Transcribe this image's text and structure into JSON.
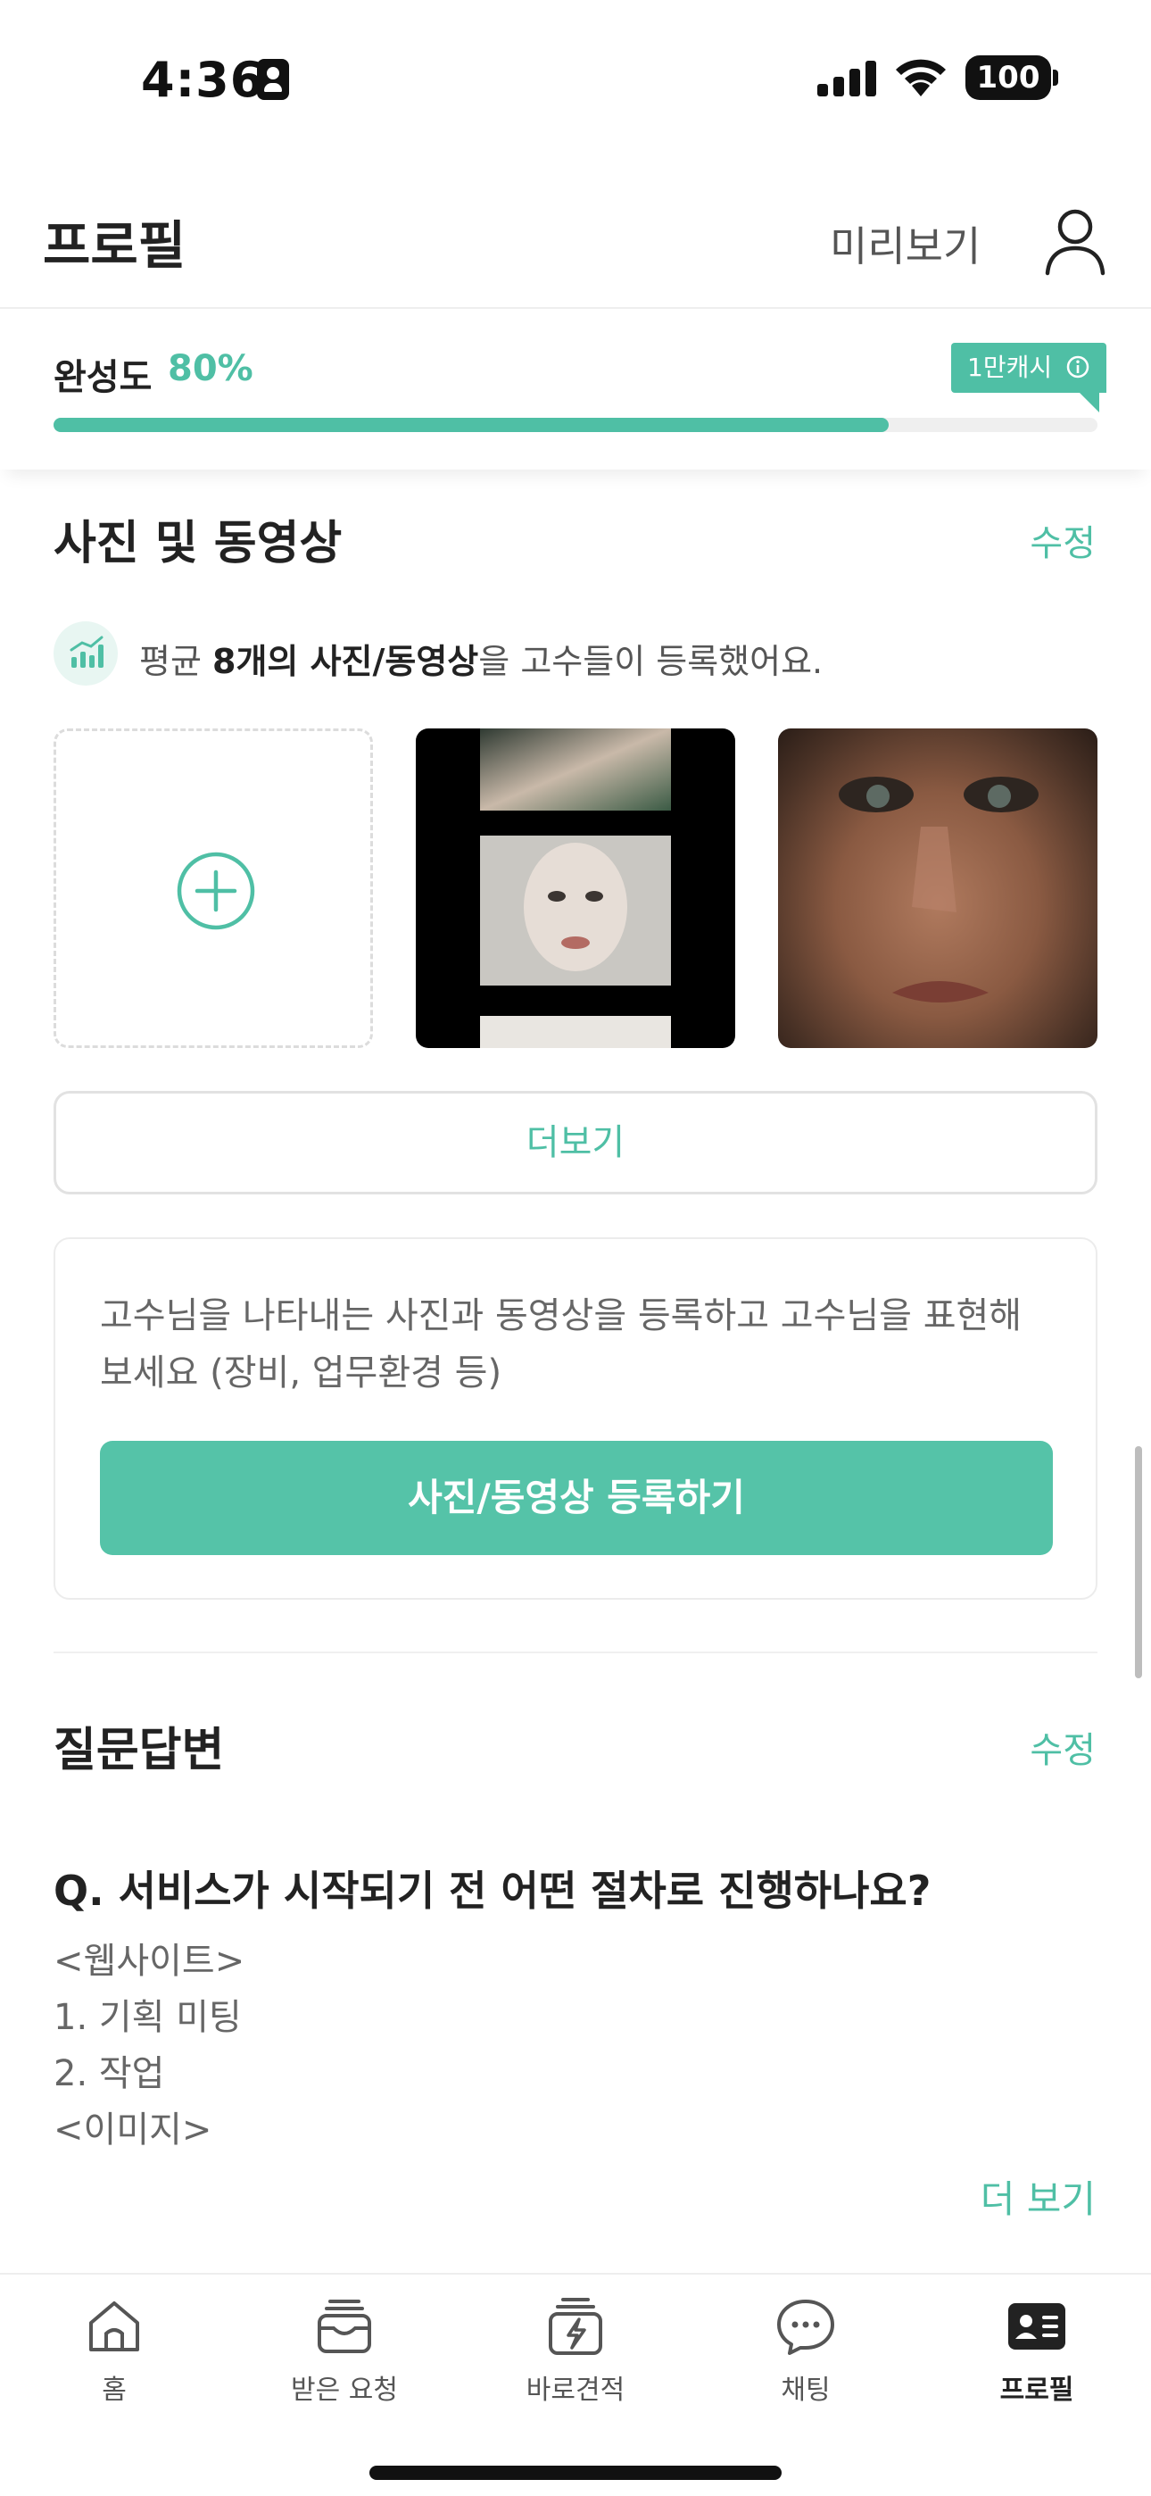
{
  "status_bar": {
    "time": "4:36",
    "battery": "100"
  },
  "header": {
    "title": "프로필",
    "preview_label": "미리보기"
  },
  "completion": {
    "label": "완성도",
    "value": "80%",
    "progress": 0.8,
    "badge_label": "1만캐시"
  },
  "media_section": {
    "title": "사진 및 동영상",
    "edit_label": "수정",
    "hint_prefix": "평균 ",
    "hint_bold": "8개의 사진/동영상",
    "hint_suffix": "을 고수들이 등록했어요.",
    "more_label": "더보기",
    "info_text": "고수님을 나타내는 사진과 동영상을 등록하고 고수님을 표현해 보세요 (장비, 업무환경 등)",
    "register_label": "사진/동영상 등록하기"
  },
  "qa_section": {
    "title": "질문답변",
    "edit_label": "수정",
    "question": "Q. 서비스가 시작되기 전 어떤 절차로 진행하나요?",
    "answer_lines": [
      "<웹사이트>",
      "1. 기획 미팅",
      "2. 작업",
      "<이미지>"
    ],
    "more_label": "더 보기"
  },
  "bottom_nav": {
    "items": [
      {
        "label": "홈",
        "icon": "home-icon"
      },
      {
        "label": "받은 요청",
        "icon": "inbox-icon"
      },
      {
        "label": "바로견적",
        "icon": "quick-quote-icon"
      },
      {
        "label": "채팅",
        "icon": "chat-icon"
      },
      {
        "label": "프로필",
        "icon": "profile-card-icon"
      }
    ],
    "active": "프로필"
  },
  "colors": {
    "accent": "#4fbfa5",
    "button": "#55c3a8"
  }
}
